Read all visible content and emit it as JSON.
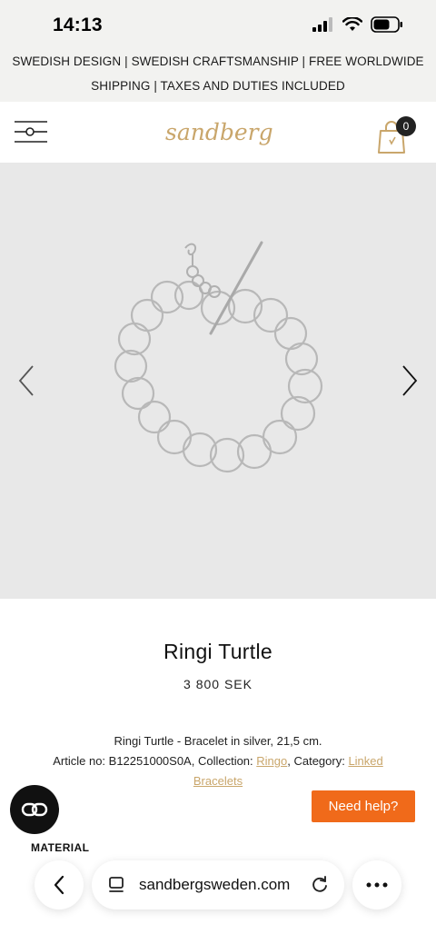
{
  "status_bar": {
    "time": "14:13"
  },
  "announcement": {
    "line1": "SWEDISH DESIGN | SWEDISH CRAFTSMANSHIP | FREE WORLDWIDE",
    "line2": "SHIPPING | TAXES AND DUTIES INCLUDED"
  },
  "header": {
    "logo_text": "sandberg",
    "cart_count": "0"
  },
  "product": {
    "title": "Ringi Turtle",
    "price": "3 800 SEK",
    "description_line1": "Ringi Turtle - Bracelet in silver, 21,5 cm.",
    "article_prefix": "Article no: B12251000S0A, Collection: ",
    "collection_link": "Ringo",
    "category_prefix": ", Category: ",
    "category_link": "Linked Bracelets"
  },
  "sections": {
    "material_label": "MATERIAL"
  },
  "help_button": {
    "label": "Need help?"
  },
  "browser": {
    "url": "sandbergsweden.com"
  },
  "colors": {
    "accent_gold": "#c9a66b",
    "help_orange": "#f06a1a",
    "announce_bg": "#f2f2f0",
    "gallery_bg": "#e8e8e8"
  }
}
